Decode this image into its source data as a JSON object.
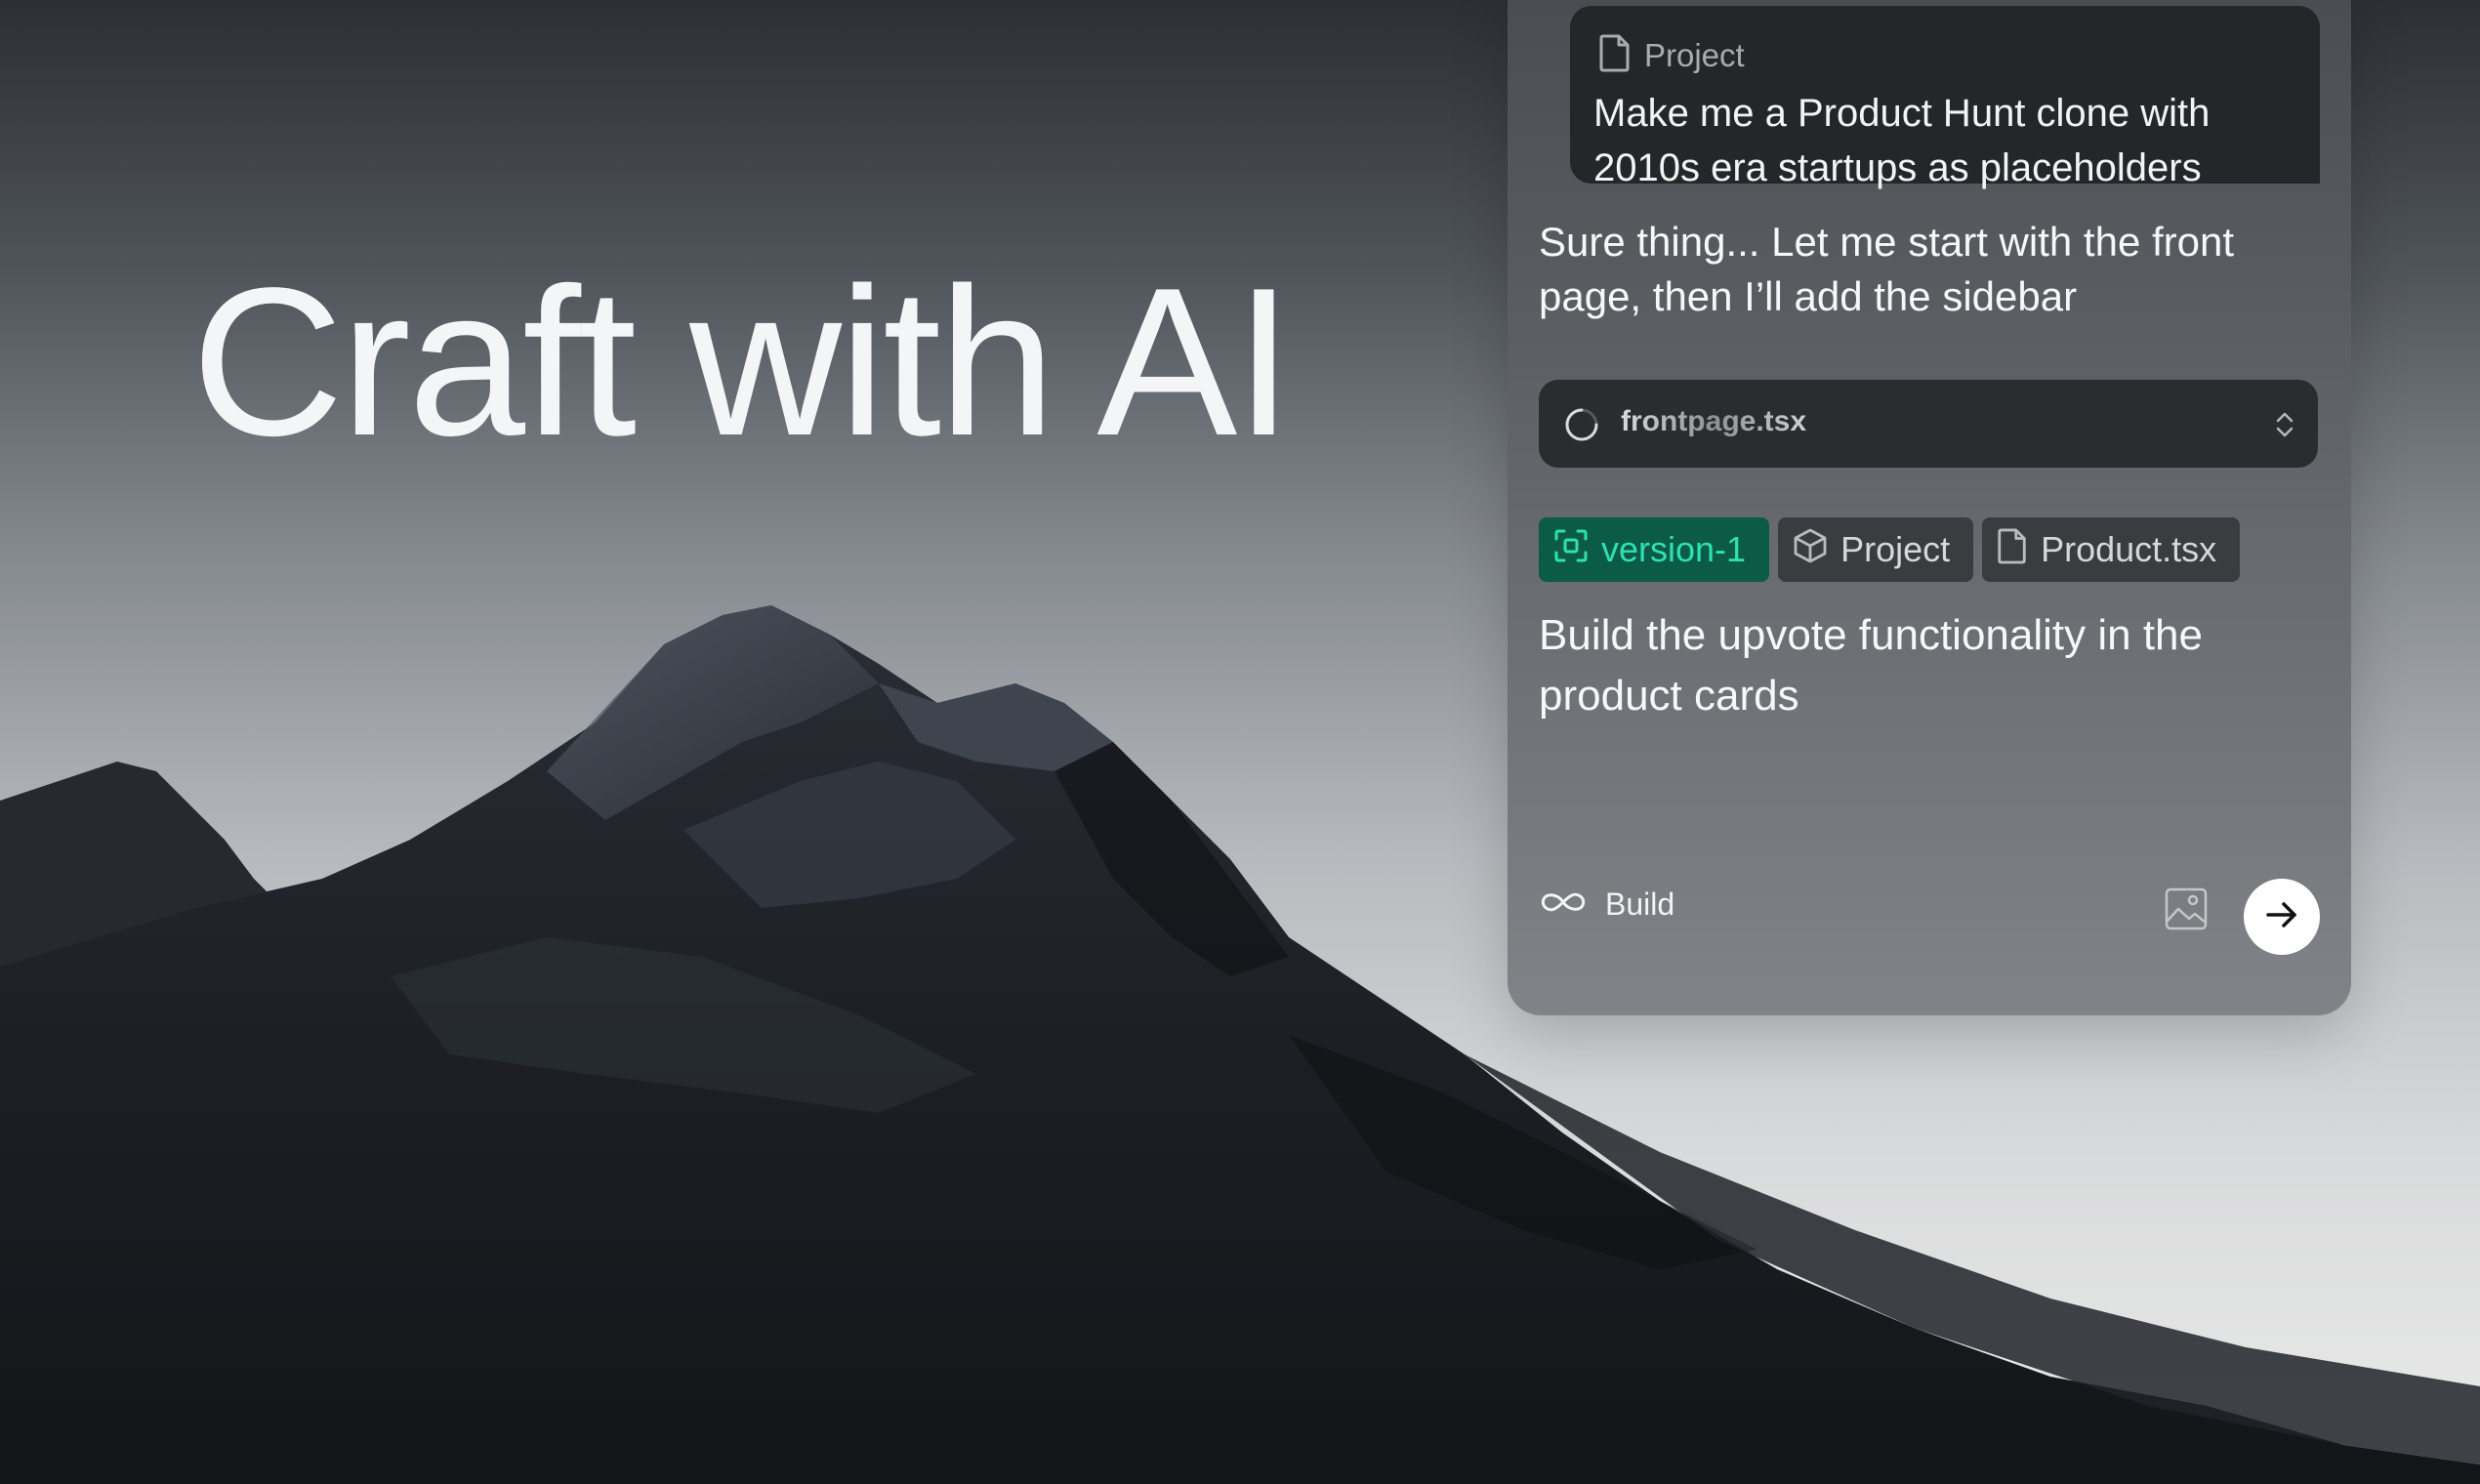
{
  "hero": {
    "title": "Craft with AI"
  },
  "chat": {
    "user_message": {
      "attachment_label": "Project",
      "text": "Make me a Product Hunt clone with 2010s era startups as placeholders"
    },
    "assistant_message": "Sure thing... Let me start with the front page, then I’ll add the sidebar",
    "file_status": {
      "name": "frontpage.tsx",
      "icon": "spinner-icon"
    },
    "context_chips": [
      {
        "label": "version-1",
        "icon": "focus-frame-icon",
        "color": "#2fe0b0"
      },
      {
        "label": "Project",
        "icon": "cube-icon"
      },
      {
        "label": "Product.tsx",
        "icon": "file-icon"
      }
    ],
    "prompt_text": "Build the upvote functionality in the product cards",
    "mode_label": "Build",
    "accent_color": "#0b5b47"
  }
}
